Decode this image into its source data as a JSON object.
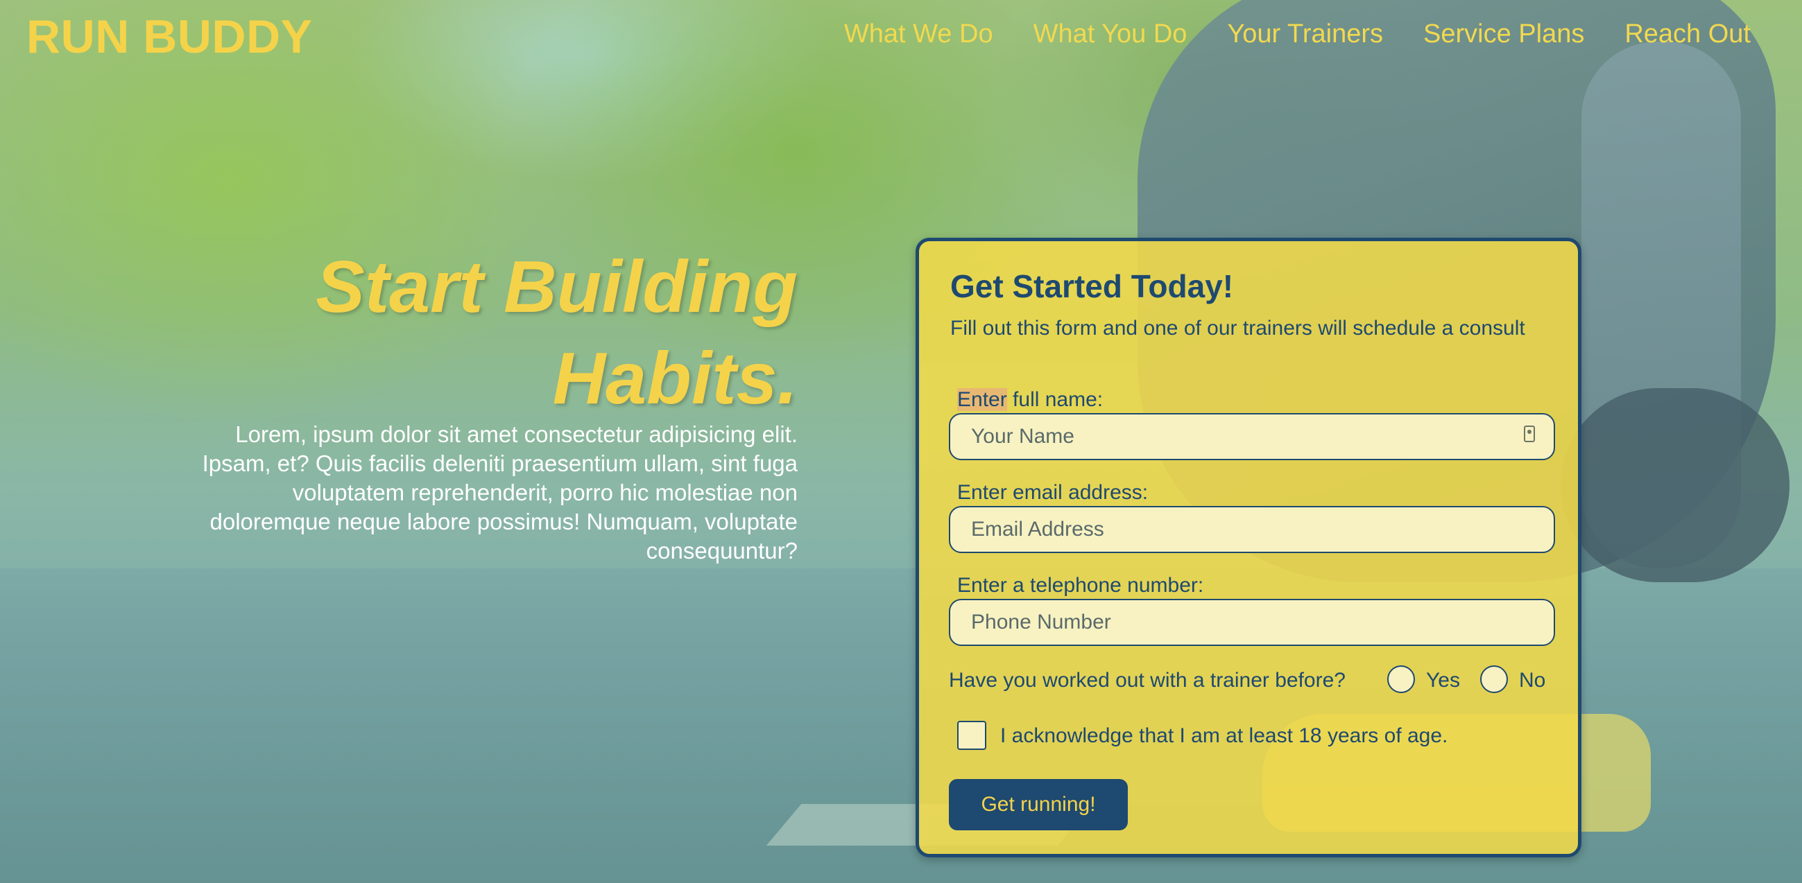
{
  "header": {
    "logo": "RUN BUDDY",
    "nav": [
      {
        "label": "What We Do"
      },
      {
        "label": "What You Do"
      },
      {
        "label": "Your Trainers"
      },
      {
        "label": "Service Plans"
      },
      {
        "label": "Reach Out"
      }
    ]
  },
  "hero": {
    "title_line1": "Start Building",
    "title_line2": "Habits.",
    "text": "Lorem, ipsum dolor sit amet consectetur adipisicing elit. Ipsam, et? Quis facilis deleniti praesentium ullam, sint fuga voluptatem reprehenderit, porro hic molestiae non doloremque neque labore possimus! Numquam, voluptate consequuntur?"
  },
  "form": {
    "title": "Get Started Today!",
    "intro": "Fill out this form and one of our trainers will schedule a consult",
    "name_label_highlight": "Enter",
    "name_label_rest": " full name:",
    "name_placeholder": "Your Name",
    "email_label": "Enter email address:",
    "email_placeholder": "Email Address",
    "phone_label": "Enter a telephone number:",
    "phone_placeholder": "Phone Number",
    "trainer_question": "Have you worked out with a trainer before?",
    "yes_label": "Yes",
    "no_label": "No",
    "age_ack": "I acknowledge that I am at least 18 years of age.",
    "submit_label": "Get running!"
  },
  "colors": {
    "brand_yellow": "#f4d34a",
    "brand_navy": "#1e4970"
  }
}
